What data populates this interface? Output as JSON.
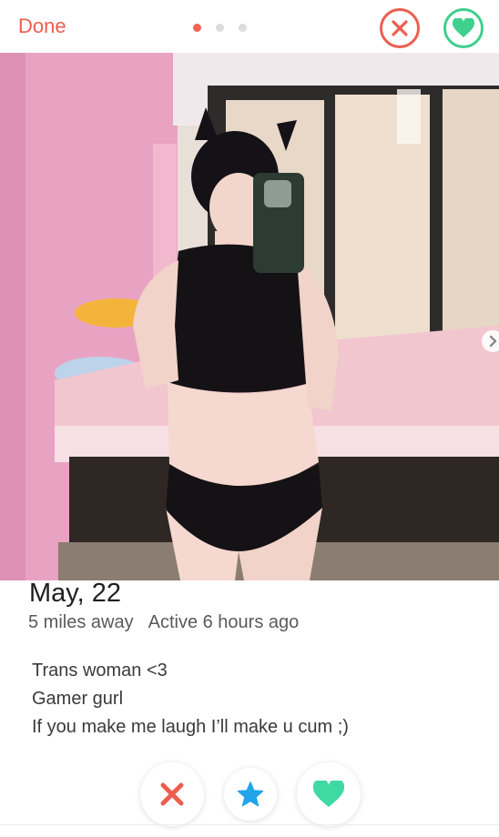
{
  "header": {
    "done_label": "Done",
    "photo_count": 3,
    "active_photo_index": 0
  },
  "profile": {
    "name_age": "May, 22",
    "distance": "5 miles away",
    "activity": "Active 6 hours ago",
    "bio": [
      "Trans woman <3",
      "Gamer gurl",
      "If you make me laugh I’ll make u cum ;)"
    ]
  },
  "icons": {
    "top_nope": "close-circle-icon",
    "top_like": "heart-circle-icon",
    "photo_next": "chevron-right-icon",
    "nope": "x-icon",
    "super_like": "star-icon",
    "like": "heart-icon"
  },
  "colors": {
    "nope": "#ec5e4f",
    "like": "#3fcf8e",
    "super_like": "#22a4e8",
    "done": "#ec5e4f"
  }
}
